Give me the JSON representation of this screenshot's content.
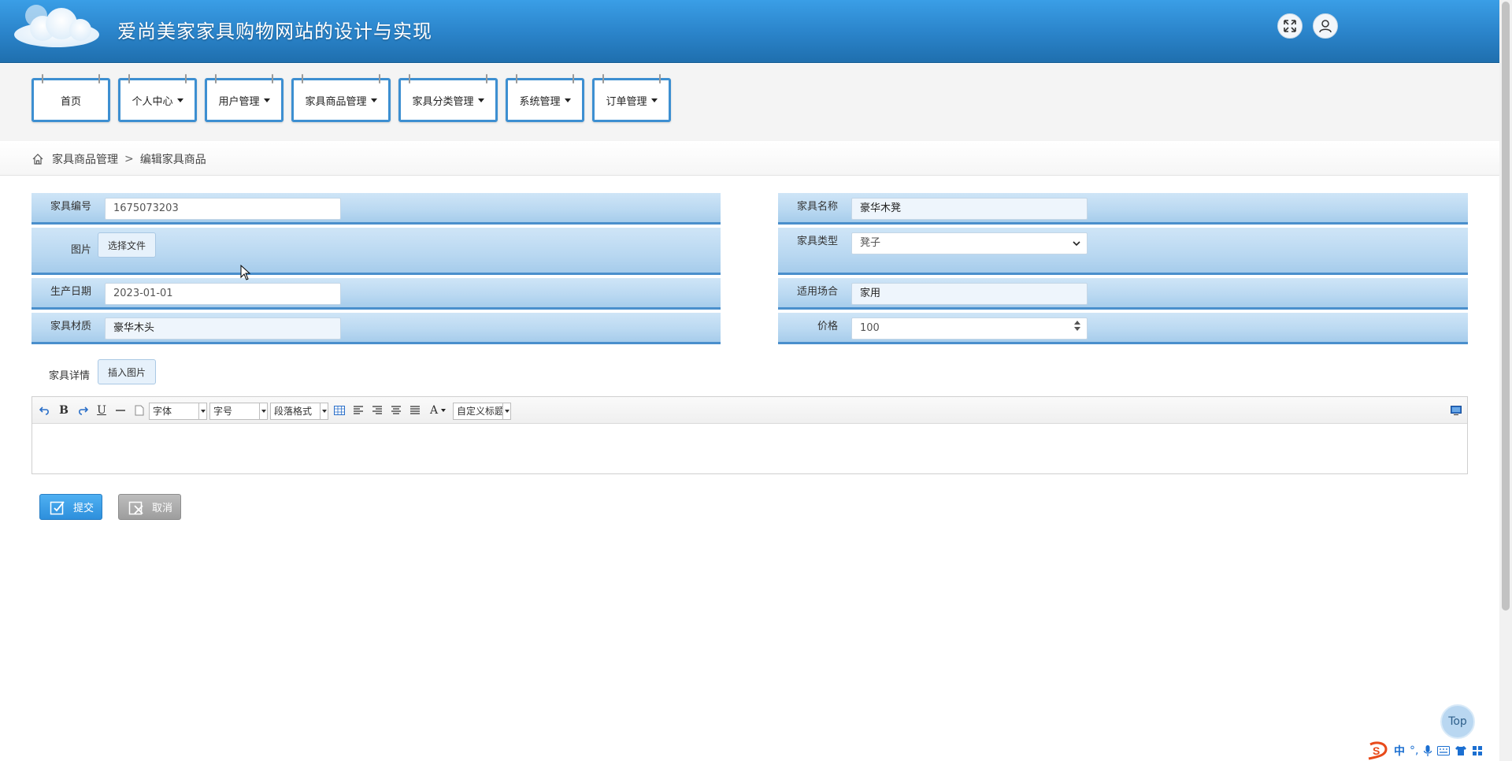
{
  "header": {
    "title": "爱尚美家家具购物网站的设计与实现",
    "fullscreen_icon": "expand-icon",
    "user_icon": "user-icon"
  },
  "nav": {
    "items": [
      {
        "label": "首页",
        "has_dropdown": false
      },
      {
        "label": "个人中心",
        "has_dropdown": true
      },
      {
        "label": "用户管理",
        "has_dropdown": true
      },
      {
        "label": "家具商品管理",
        "has_dropdown": true
      },
      {
        "label": "家具分类管理",
        "has_dropdown": true
      },
      {
        "label": "系统管理",
        "has_dropdown": true
      },
      {
        "label": "订单管理",
        "has_dropdown": true
      }
    ]
  },
  "breadcrumb": {
    "parent": "家具商品管理",
    "separator": ">",
    "current": "编辑家具商品"
  },
  "form": {
    "furniture_no": {
      "label": "家具编号",
      "value": "1675073203"
    },
    "furniture_name": {
      "label": "家具名称",
      "value": "豪华木凳"
    },
    "image": {
      "label": "图片",
      "button": "选择文件"
    },
    "furniture_type": {
      "label": "家具类型",
      "value": "凳子"
    },
    "production_date": {
      "label": "生产日期",
      "value": "2023-01-01"
    },
    "occasion": {
      "label": "适用场合",
      "value": "家用"
    },
    "material": {
      "label": "家具材质",
      "value": "豪华木头"
    },
    "price": {
      "label": "价格",
      "value": "100"
    },
    "details": {
      "label": "家具详情",
      "insert_image_button": "插入图片"
    }
  },
  "editor": {
    "font_family": "字体",
    "font_size": "字号",
    "paragraph": "段落格式",
    "custom_title": "自定义标题",
    "bold": "B",
    "underline": "U",
    "text_color": "A"
  },
  "actions": {
    "submit": "提交",
    "cancel": "取消"
  },
  "top_button": "Top",
  "ime": {
    "lang": "中"
  },
  "colors": {
    "header_blue": "#2a83c9",
    "row_blue": "#b9d8f1",
    "row_border": "#4a8fcc",
    "submit_blue": "#2d8fdc",
    "cancel_grey": "#9d9d9d"
  }
}
